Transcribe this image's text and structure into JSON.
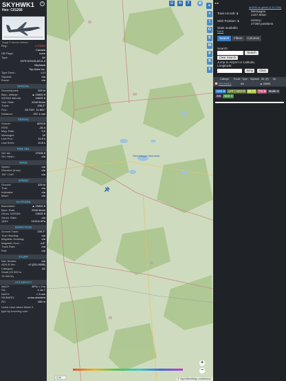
{
  "info": {
    "callsign": "SKYHWK1",
    "hex_label": "Hex:",
    "hex": "C01266",
    "photo_credit": "Image © Werner Veitwan",
    "basic": [
      {
        "k": "Reg.:",
        "v": "C-FDZD",
        "red": true
      },
      {
        "k": "",
        "v": "Canada"
      },
      {
        "k": "DB Flags:",
        "v": "none"
      },
      {
        "k": "Type:",
        "v": "A4"
      },
      {
        "k": "",
        "v": "1973 DOUGLAS A-4"
      },
      {
        "k": "",
        "v": "Skyhawk"
      },
      {
        "k": "",
        "v": "Top Aces Inc."
      },
      {
        "k": "Type Desc.:",
        "v": "L1J"
      },
      {
        "k": "Squawk:",
        "v": "n/a"
      },
      {
        "k": "Route:",
        "v": "n/a"
      }
    ],
    "sections": [
      {
        "title": "SPATIAL",
        "rows": [
          {
            "k": "Groundspeed:",
            "v": "329 kt"
          },
          {
            "k": "Baro. altitude:",
            "v": "▲ 23400 ft"
          },
          {
            "k": "WGS84 altitude:",
            "v": "24025 ft"
          },
          {
            "k": "Vert. Rate:",
            "v": "2240 ft/min"
          },
          {
            "k": "Track:",
            "v": "230.2°"
          },
          {
            "k": "Pos.:",
            "v": "53.715°, 11.651°"
          },
          {
            "k": "Distance:",
            "v": "207.1 nmi"
          }
        ]
      },
      {
        "title": "SIGNAL",
        "rows": [
          {
            "k": "Source:",
            "v": "ADS-B"
          },
          {
            "k": "RSSI:",
            "v": "-26.3"
          },
          {
            "k": "Msg. Rate:",
            "v": "0.0"
          },
          {
            "k": "Messages:",
            "v": "39"
          },
          {
            "k": "Last Pos.:",
            "v": "11.8 s"
          },
          {
            "k": "Last Seen:",
            "v": "10.8 s"
          }
        ]
      },
      {
        "title": "FMS SEL",
        "rows": [
          {
            "k": "Sel. Alt.:",
            "v": "27008 ft"
          },
          {
            "k": "Sel. Head.:",
            "v": "n/a"
          }
        ]
      },
      {
        "title": "WIND",
        "rows": [
          {
            "k": "Speed:",
            "v": "n/a"
          },
          {
            "k": "Direction (from):",
            "v": "n/a"
          },
          {
            "k": "TAT / OAT:",
            "v": "n/a"
          }
        ]
      },
      {
        "title": "SPEED",
        "rows": [
          {
            "k": "Ground:",
            "v": "329 kt"
          },
          {
            "k": "True:",
            "v": "n/a"
          },
          {
            "k": "Indicated:",
            "v": "n/a"
          },
          {
            "k": "Mach:",
            "v": "n/a"
          }
        ]
      },
      {
        "title": "ALTITUDE",
        "rows": [
          {
            "k": "Barometric:",
            "v": "▲ 23400 ft"
          },
          {
            "k": "Baro. Rate:",
            "v": "2240 ft/min"
          },
          {
            "k": "Geom. WGS84:",
            "v": "24025 ft"
          },
          {
            "k": "Geom. Rate:",
            "v": "n/a"
          },
          {
            "k": "QNH:",
            "v": "1013.6 hPa"
          }
        ]
      },
      {
        "title": "DIRECTION",
        "rows": [
          {
            "k": "Ground Track:",
            "v": "230.2°"
          },
          {
            "k": "True Heading:",
            "v": "n/a"
          },
          {
            "k": "Magnetic Heading:",
            "v": "n/a"
          },
          {
            "k": "Magnetic Decl.:",
            "v": "4.8°"
          },
          {
            "k": "Track Rate:",
            "v": "n/a"
          },
          {
            "k": "Roll:",
            "v": "n/a"
          }
        ]
      },
      {
        "title": "STUFF",
        "rows": [
          {
            "k": "Nav. Modes:",
            "v": "n/a"
          },
          {
            "k": "ADS-B Ver.:",
            "v": "v2 (DO-260B)"
          },
          {
            "k": "Category:",
            "v": "A2"
          },
          {
            "k": "Small (15 500 to",
            "v": ""
          },
          {
            "k": "75 000 lb)",
            "v": ""
          }
        ]
      },
      {
        "title": "ACCURACY",
        "rows": [
          {
            "k": "NACP:",
            "v": "EPU < 3 m"
          },
          {
            "k": "SIL:",
            "v": "≤ 1e-7"
          },
          {
            "k": "NACV:",
            "v": "< 3 m/s"
          },
          {
            "k": "NICBARO:",
            "v": "cross-checked"
          },
          {
            "k": "RC:",
            "v": "186 m"
          }
        ]
      }
    ],
    "footer1": "Learn more about Mode S",
    "footer2": "type by hovering over"
  },
  "map": {
    "top_buttons": [
      "U",
      "H",
      "T"
    ],
    "place_labels": [
      "Sternberger Seenland"
    ],
    "scale_label": "5 NM",
    "attribution": "© OpenStreetMap contributors."
  },
  "side_buttons": [
    "<",
    "I",
    "O",
    "K",
    "M",
    "P",
    "R",
    "F"
  ],
  "panel": {
    "link": "tar1090 on github (3.14.1706)",
    "total_label": "Total Aircraft:",
    "total": "1",
    "pos_label": "With Position:",
    "pos": "1",
    "stats_label": "Stats available",
    "stats_link": "here",
    "msgs_label": "Messages:",
    "msgs": "1447.9/sec",
    "hist_label": "History:",
    "hist": "27268 positions",
    "tabs": [
      "Search",
      "Filters",
      "Columns"
    ],
    "search_label": "Search:",
    "search_btn": "Search",
    "clear_btn": "Clear Search",
    "jump_label": "Jump to Airport or Latitude, Longitude:",
    "jump_btn": "Jump",
    "clear2_btn": "Clear",
    "columns": [
      "Callsign",
      "Route",
      "Type",
      "Squawk",
      "Alt. (ft)",
      "Sp"
    ],
    "row": {
      "callsign": "SKYHWK1",
      "type": "A4",
      "alt": "▲ 23400"
    },
    "tags": [
      {
        "label": "ADS-B",
        "bg": "#2a7bc9"
      },
      {
        "label": "UAT / ADS-R",
        "bg": "#6a7e3b"
      },
      {
        "label": "MLAT",
        "bg": "#a4c43a"
      },
      {
        "label": "TIS-B",
        "bg": "#c55b80"
      },
      {
        "label": "Mode-S",
        "bg": "#3a4149"
      },
      {
        "label": "AIS",
        "bg": "#4a2b5a"
      },
      {
        "label": "ADS-C",
        "bg": "#3f8f3f"
      }
    ]
  }
}
